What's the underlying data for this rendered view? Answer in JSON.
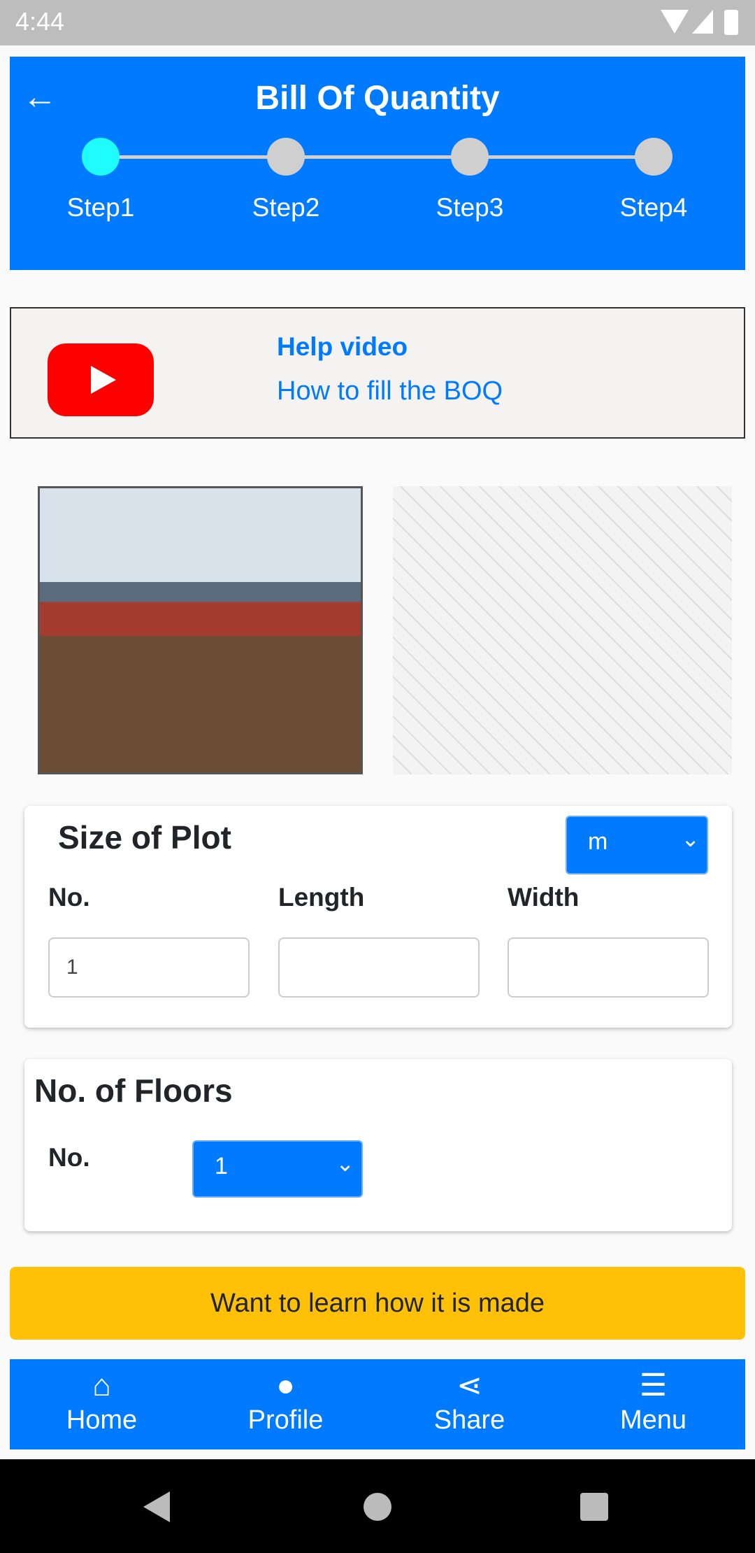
{
  "status_bar": {
    "time": "4:44",
    "icons": [
      "wifi-icon",
      "signal-icon",
      "battery-icon"
    ]
  },
  "header": {
    "title": "Bill Of Quantity",
    "back_icon": "arrow-left-icon",
    "steps": [
      {
        "label": "Step1",
        "active": true
      },
      {
        "label": "Step2",
        "active": false
      },
      {
        "label": "Step3",
        "active": false
      },
      {
        "label": "Step4",
        "active": false
      }
    ]
  },
  "help": {
    "title": "Help video",
    "subtitle": "How to fill the BOQ",
    "icon": "youtube-icon"
  },
  "plot": {
    "title": "Size of Plot",
    "unit": "m",
    "labels": {
      "no": "No.",
      "length": "Length",
      "width": "Width"
    },
    "values": {
      "no": "1",
      "length": "",
      "width": ""
    }
  },
  "floors": {
    "title": "No. of Floors",
    "label": "No.",
    "value": "1"
  },
  "learn_button": "Want to learn how it is made",
  "nav": [
    {
      "label": "Home",
      "icon": "home-icon"
    },
    {
      "label": "Profile",
      "icon": "user-icon"
    },
    {
      "label": "Share",
      "icon": "share-icon"
    },
    {
      "label": "Menu",
      "icon": "menu-icon"
    }
  ],
  "colors": {
    "primary": "#007bff",
    "active_step": "#1ffcff",
    "button": "#ffc107"
  }
}
